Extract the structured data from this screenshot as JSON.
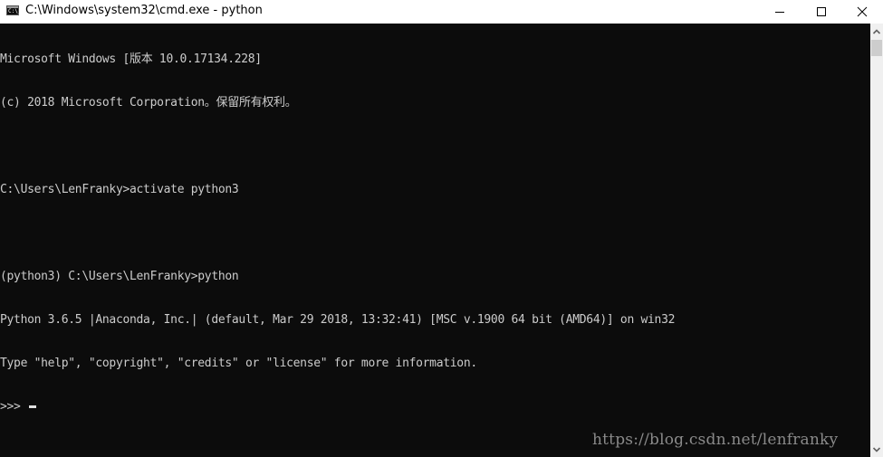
{
  "window": {
    "title": "C:\\Windows\\system32\\cmd.exe - python",
    "icon_text": "C:\\_",
    "buttons": [
      "minimize",
      "maximize",
      "close"
    ]
  },
  "console": {
    "lines": [
      "Microsoft Windows [版本 10.0.17134.228]",
      "(c) 2018 Microsoft Corporation。保留所有权利。",
      "",
      "C:\\Users\\LenFranky>activate python3",
      "",
      "(python3) C:\\Users\\LenFranky>python",
      "Python 3.6.5 |Anaconda, Inc.| (default, Mar 29 2018, 13:32:41) [MSC v.1900 64 bit (AMD64)] on win32",
      "Type \"help\", \"copyright\", \"credits\" or \"license\" for more information.",
      ">>> "
    ]
  },
  "watermark": "https://blog.csdn.net/lenfranky",
  "colors": {
    "console_bg": "#0c0c0c",
    "console_fg": "#cccccc",
    "titlebar_bg": "#ffffff"
  }
}
